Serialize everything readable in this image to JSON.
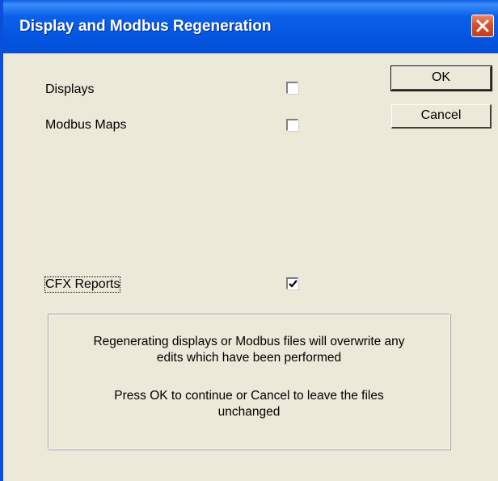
{
  "window": {
    "title": "Display and Modbus Regeneration"
  },
  "options": {
    "displays": {
      "label": "Displays",
      "checked": false
    },
    "modbus_maps": {
      "label": "Modbus Maps",
      "checked": false
    },
    "cfx_reports": {
      "label": "CFX Reports",
      "checked": true
    }
  },
  "buttons": {
    "ok_label": "OK",
    "cancel_label": "Cancel"
  },
  "message": {
    "line1": "Regenerating displays or Modbus files will overwrite any",
    "line2": "edits which have been performed",
    "line3": "Press OK to continue or Cancel to leave the files",
    "line4": "unchanged"
  },
  "icons": {
    "close": "close-icon",
    "check": "checkmark-icon"
  },
  "colors": {
    "titlebar": "#0455e0",
    "close_button": "#d8502c",
    "dialog_face": "#ece9d8"
  }
}
